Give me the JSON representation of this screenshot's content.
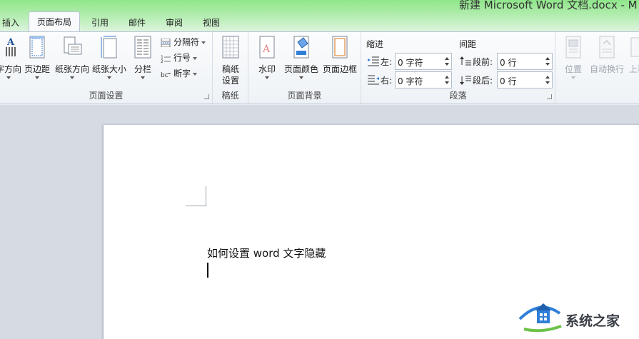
{
  "window": {
    "title": "新建 Microsoft Word 文档.docx - M"
  },
  "tabs": [
    {
      "label": "插入"
    },
    {
      "label": "页面布局"
    },
    {
      "label": "引用"
    },
    {
      "label": "邮件"
    },
    {
      "label": "审阅"
    },
    {
      "label": "视图"
    }
  ],
  "ribbon": {
    "page_setup": {
      "label": "页面设置",
      "buttons": {
        "text_direction": "字方向",
        "margins": "页边距",
        "orientation": "纸张方向",
        "size": "纸张大小",
        "columns": "分栏"
      },
      "small": {
        "breaks": "分隔符",
        "line_numbers": "行号",
        "hyphenation": "断字"
      }
    },
    "draft_paper": {
      "label": "稿纸",
      "button_line1": "稿纸",
      "button_line2": "设置"
    },
    "page_background": {
      "label": "页面背景",
      "watermark": "水印",
      "page_color": "页面颜色",
      "page_borders": "页面边框"
    },
    "paragraph": {
      "label": "段落",
      "indent_heading": "缩进",
      "spacing_heading": "间距",
      "indent_left_label": "左:",
      "indent_left_value": "0 字符",
      "indent_right_label": "右:",
      "indent_right_value": "0 字符",
      "space_before_label": "段前:",
      "space_before_value": "0 行",
      "space_after_label": "段后:",
      "space_after_value": "0 行"
    },
    "arrange": {
      "position": "位置",
      "wrap_text": "自动换行",
      "bring_forward": "上移"
    }
  },
  "document": {
    "line1": "如何设置 word 文字隐藏"
  },
  "watermark_site": {
    "text": "系统之家"
  },
  "colors": {
    "titlebar_green": "#8fe68a",
    "ribbon_bg": "#f3f6f9",
    "doc_bg": "#d6dbe3",
    "watermark_blue": "#2f7fd8"
  }
}
